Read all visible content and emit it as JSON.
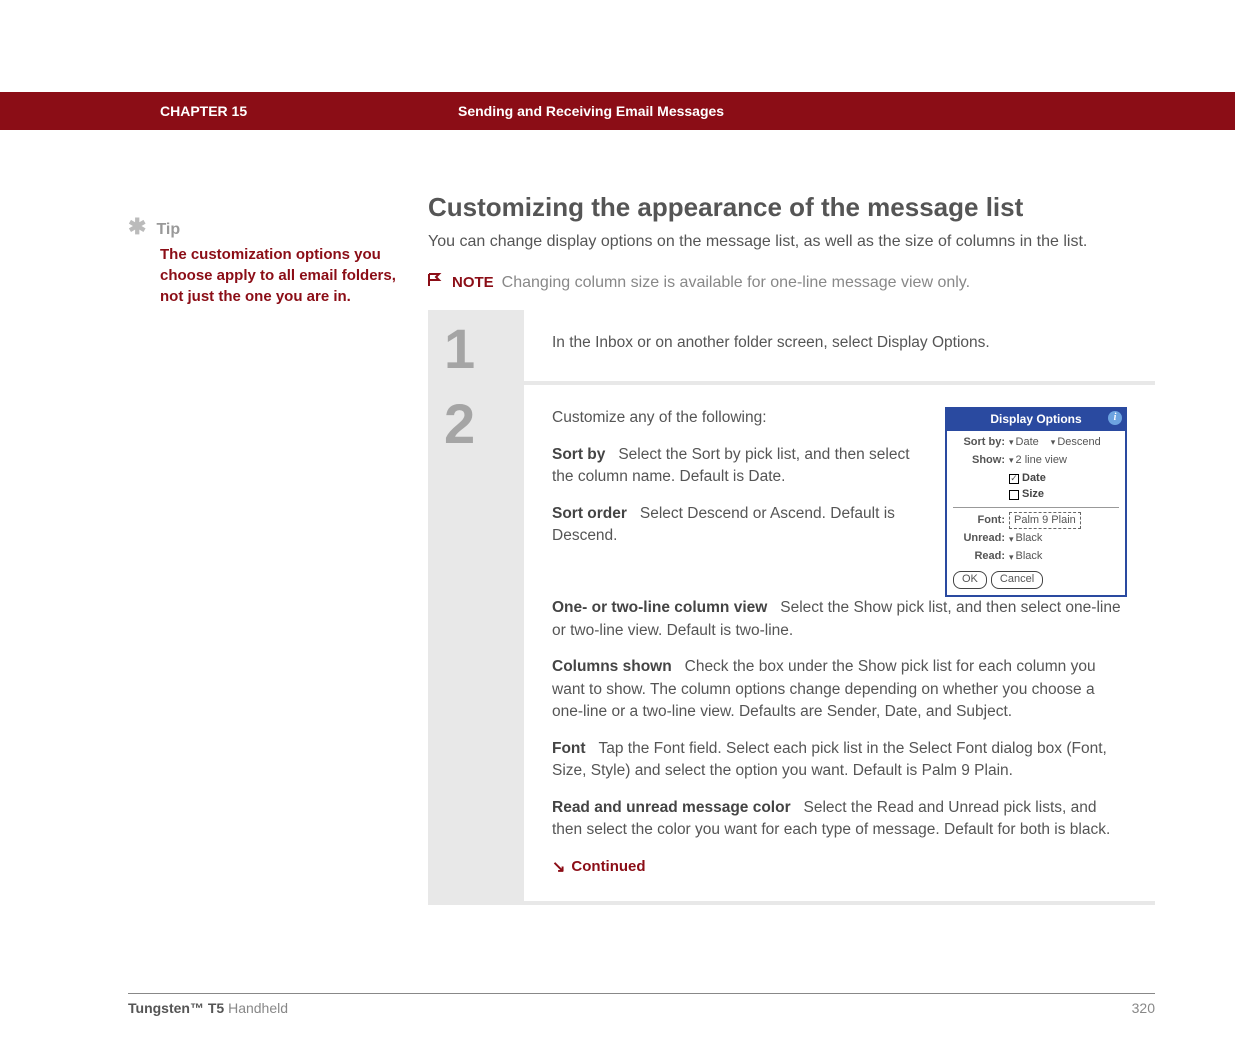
{
  "header": {
    "chapter": "CHAPTER 15",
    "section": "Sending and Receiving Email Messages"
  },
  "sidebar": {
    "tip_icon": "✱",
    "tip_label": "Tip",
    "tip_body": "The customization options you choose apply to all email folders, not just the one you are in."
  },
  "main": {
    "title": "Customizing the appearance of the message list",
    "intro": "You can change display options on the message list, as well as the size of columns in the list.",
    "note_label": "NOTE",
    "note_text": "Changing column size is available for one-line message view only.",
    "step1_num": "1",
    "step1_text": "In the Inbox or on another folder screen, select Display Options.",
    "step2_num": "2",
    "step2_lead": "Customize any of the following:",
    "sortby_label": "Sort by",
    "sortby_text": "Select the Sort by pick list, and then select the column name. Default is Date.",
    "sortorder_label": "Sort order",
    "sortorder_text": "Select Descend or Ascend. Default is Descend.",
    "colview_label": "One- or two-line column view",
    "colview_text": "Select the Show pick list, and then select one-line or two-line view. Default is two-line.",
    "colshown_label": "Columns shown",
    "colshown_text": "Check the box under the Show pick list for each column you want to show. The column options change depending on whether you choose a one-line or a two-line view. Defaults are Sender, Date, and Subject.",
    "font_label": "Font",
    "font_text": "Tap the Font field. Select each pick list in the Select Font dialog box (Font, Size, Style) and select the option you want. Default is Palm 9 Plain.",
    "readcolor_label": "Read and unread message color",
    "readcolor_text": "Select the Read and Unread pick lists, and then select the color you want for each type of message. Default for both is black.",
    "continued": "Continued"
  },
  "palm": {
    "title": "Display Options",
    "info": "i",
    "sortby_label": "Sort by:",
    "sortby_value": "Date",
    "sortorder_value": "Descend",
    "show_label": "Show:",
    "show_value": "2 line view",
    "date_label": "Date",
    "date_checked": "✓",
    "size_label": "Size",
    "font_label": "Font:",
    "font_value": "Palm 9 Plain",
    "unread_label": "Unread:",
    "unread_value": "Black",
    "read_label": "Read:",
    "read_value": "Black",
    "ok": "OK",
    "cancel": "Cancel"
  },
  "footer": {
    "product_bold": "Tungsten™ T5",
    "product_light": " Handheld",
    "page": "320"
  }
}
